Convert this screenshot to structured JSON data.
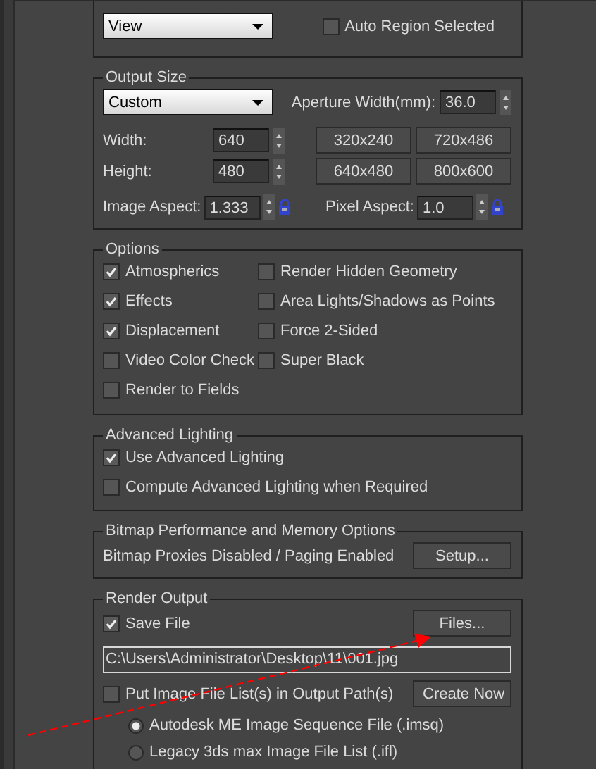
{
  "area_to_render": {
    "dropdown": "View",
    "auto_region": {
      "label": "Auto Region Selected",
      "checked": false
    }
  },
  "output_size": {
    "title": "Output Size",
    "preset": "Custom",
    "aperture": {
      "label": "Aperture Width(mm):",
      "value": "36.0"
    },
    "width": {
      "label": "Width:",
      "value": "640"
    },
    "height": {
      "label": "Height:",
      "value": "480"
    },
    "presets": [
      "320x240",
      "720x486",
      "640x480",
      "800x600"
    ],
    "image_aspect": {
      "label": "Image Aspect:",
      "value": "1.333"
    },
    "pixel_aspect": {
      "label": "Pixel Aspect:",
      "value": "1.0"
    }
  },
  "options": {
    "title": "Options",
    "items": [
      {
        "label": "Atmospherics",
        "checked": true
      },
      {
        "label": "Render Hidden Geometry",
        "checked": false
      },
      {
        "label": "Effects",
        "checked": true
      },
      {
        "label": "Area Lights/Shadows as Points",
        "checked": false
      },
      {
        "label": "Displacement",
        "checked": true
      },
      {
        "label": "Force 2-Sided",
        "checked": false
      },
      {
        "label": "Video Color Check",
        "checked": false
      },
      {
        "label": "Super Black",
        "checked": false
      },
      {
        "label": "Render to Fields",
        "checked": false
      }
    ]
  },
  "advanced_lighting": {
    "title": "Advanced Lighting",
    "items": [
      {
        "label": "Use Advanced Lighting",
        "checked": true
      },
      {
        "label": "Compute Advanced Lighting when Required",
        "checked": false
      }
    ]
  },
  "bitmap": {
    "title": "Bitmap Performance and Memory Options",
    "status": "Bitmap Proxies Disabled / Paging Enabled",
    "button": "Setup..."
  },
  "render_output": {
    "title": "Render Output",
    "save_file": {
      "label": "Save File",
      "checked": true
    },
    "files_button": "Files...",
    "path": "C:\\Users\\Administrator\\Desktop\\11\\001.jpg",
    "put_list": {
      "label": "Put Image File List(s) in Output Path(s)",
      "checked": false
    },
    "create_button": "Create Now",
    "formats": [
      {
        "label": "Autodesk ME Image Sequence File (.imsq)",
        "selected": true
      },
      {
        "label": "Legacy 3ds max Image File List (.ifl)",
        "selected": false
      }
    ]
  }
}
